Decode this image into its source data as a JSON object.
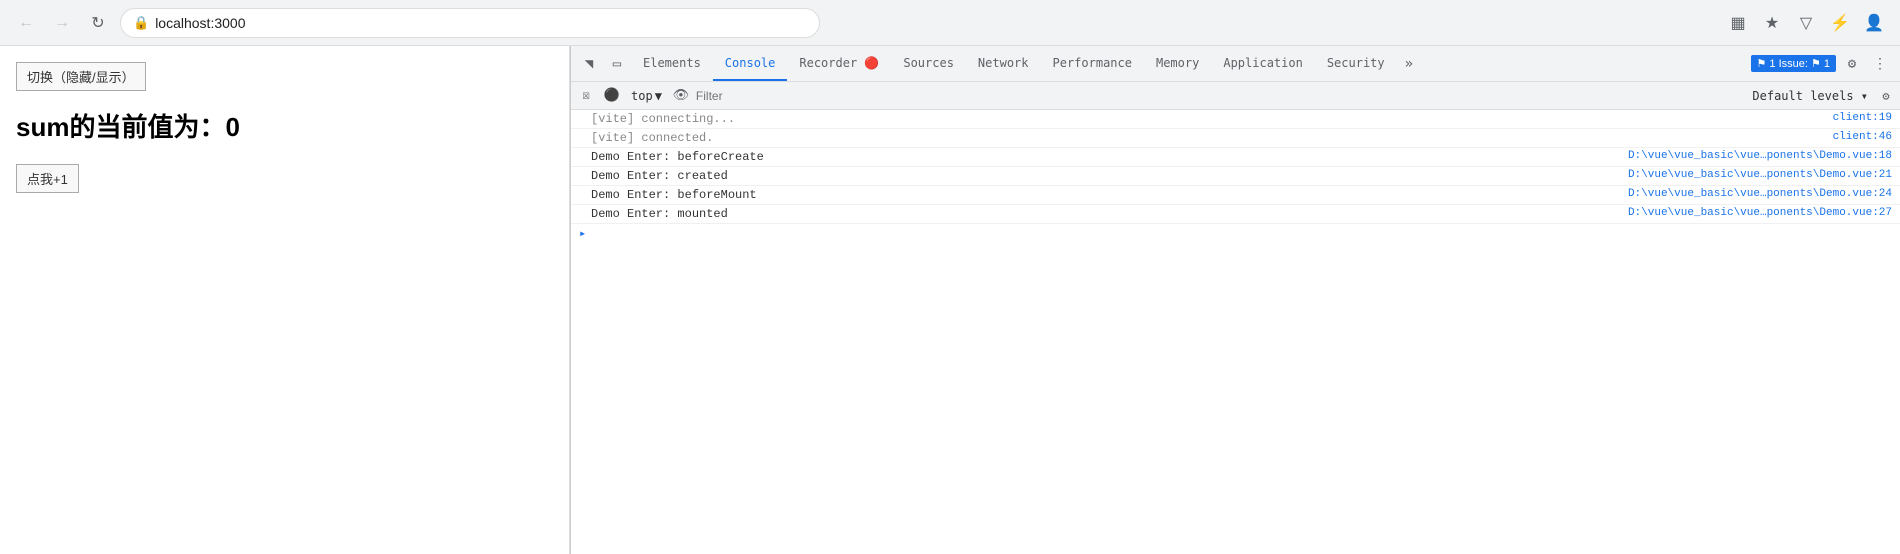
{
  "browser": {
    "url": "localhost:3000",
    "back_disabled": true,
    "forward_disabled": true
  },
  "page": {
    "toggle_btn_label": "切换（隐藏/显示）",
    "heading": "sum的当前值为：0",
    "increment_btn_label": "点我+1"
  },
  "devtools": {
    "tabs": [
      {
        "id": "elements",
        "label": "Elements",
        "active": false
      },
      {
        "id": "console",
        "label": "Console",
        "active": true
      },
      {
        "id": "recorder",
        "label": "Recorder 🔴",
        "active": false
      },
      {
        "id": "sources",
        "label": "Sources",
        "active": false
      },
      {
        "id": "network",
        "label": "Network",
        "active": false
      },
      {
        "id": "performance",
        "label": "Performance",
        "active": false
      },
      {
        "id": "memory",
        "label": "Memory",
        "active": false
      },
      {
        "id": "application",
        "label": "Application",
        "active": false
      },
      {
        "id": "security",
        "label": "Security",
        "active": false
      }
    ],
    "more_tabs_label": "»",
    "issues_count": "1",
    "issues_label": "1 Issue:",
    "console_toolbar": {
      "top_label": "top",
      "filter_placeholder": "Filter",
      "default_levels_label": "Default levels ▾"
    },
    "console_lines": [
      {
        "text": "[vite] connecting...",
        "source": "client:19",
        "gray": true
      },
      {
        "text": "[vite] connected.",
        "source": "client:46",
        "gray": true
      },
      {
        "text": "Demo Enter:  beforeCreate",
        "source": "D:\\vue\\vue_basic\\vue…ponents\\Demo.vue:18",
        "gray": false
      },
      {
        "text": "Demo Enter:  created",
        "source": "D:\\vue\\vue_basic\\vue…ponents\\Demo.vue:21",
        "gray": false
      },
      {
        "text": "Demo Enter:  beforeMount",
        "source": "D:\\vue\\vue_basic\\vue…ponents\\Demo.vue:24",
        "gray": false
      },
      {
        "text": "Demo Enter:  mounted",
        "source": "D:\\vue\\vue_basic\\vue…ponents\\Demo.vue:27",
        "gray": false
      }
    ]
  }
}
